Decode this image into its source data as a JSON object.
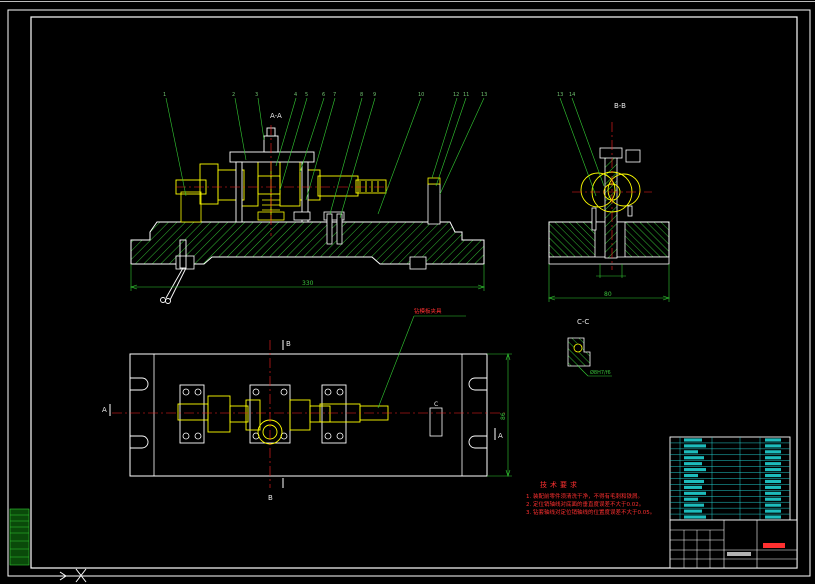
{
  "views": {
    "front_view": {
      "section_label": "A-A",
      "dimension": "330",
      "part_numbers": [
        "1",
        "2",
        "3",
        "4",
        "5",
        "6",
        "7",
        "8",
        "9",
        "10",
        "12",
        "11",
        "13"
      ]
    },
    "side_view": {
      "section_label": "B-B",
      "dimension": "80",
      "part_numbers": [
        "13",
        "14"
      ]
    },
    "plan_view": {
      "cut_marks": [
        "B",
        "B",
        "A",
        "A"
      ],
      "callout": "钻模板夹具",
      "dimension": "86",
      "side_mark": "C"
    },
    "detail_view": {
      "section_label": "C-C",
      "note": "Ø8H7/f6"
    }
  },
  "technical_requirements": {
    "title": "技术要求",
    "items": [
      "1. 装配前零件须清洗干净，不得有毛刺和铁屑。",
      "2. 定位销轴线对底面的垂直度误差不大于0.02。",
      "3. 钻套轴线对定位销轴线的位置度误差不大于0.05。"
    ]
  },
  "colors": {
    "background": "#000000",
    "frame": "#ffffff",
    "outline": "#ffffff",
    "part": "#ffff00",
    "leader": "#33cc33",
    "dimension": "#33cc33",
    "section": "#33bb33",
    "centerline": "#ff2020",
    "requirements": "#ff3030",
    "table": "#22dddd"
  },
  "icons": [
    "ucs-axis-icon"
  ]
}
